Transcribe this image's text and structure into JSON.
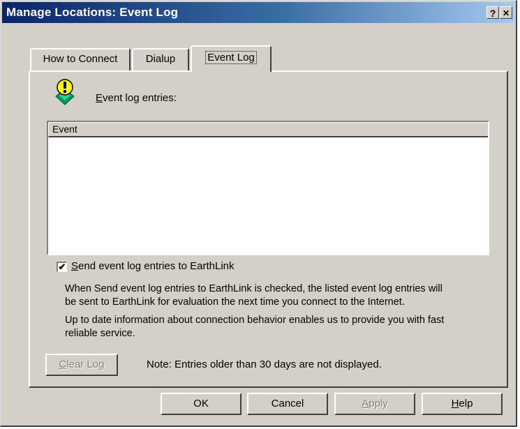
{
  "window": {
    "title": "Manage Locations:  Event Log",
    "help_btn": "?",
    "close_btn": "✕"
  },
  "tabs": [
    {
      "label": "How to Connect"
    },
    {
      "label": "Dialup"
    },
    {
      "label": "Event Log"
    }
  ],
  "event_log": {
    "entries_label_first": "E",
    "entries_label_rest": "vent log entries:",
    "column_header": "Event",
    "entries": [],
    "send_checked": true,
    "send_check_glyph": "✔",
    "send_label_first": "S",
    "send_label_rest": "end event log entries to EarthLink",
    "info_line1": "When Send event log entries to EarthLink is checked, the listed event log entries will",
    "info_line2": "be sent to EarthLink for evaluation the next time you connect to the Internet.",
    "info_line3": "Up to date information about connection behavior enables us to provide you with fast",
    "info_line4": "reliable service.",
    "clear_first": "C",
    "clear_rest": "lear Log",
    "note": "Note: Entries older than 30 days are not displayed."
  },
  "buttons": {
    "ok": "OK",
    "cancel": "Cancel",
    "apply_first": "A",
    "apply_rest": "pply",
    "help_first": "H",
    "help_rest": "elp"
  },
  "colors": {
    "face": "#d4d0c8",
    "title_start": "#0a246a",
    "title_end": "#a6caf0",
    "icon_yellow": "#ffff00",
    "icon_green": "#009966"
  }
}
